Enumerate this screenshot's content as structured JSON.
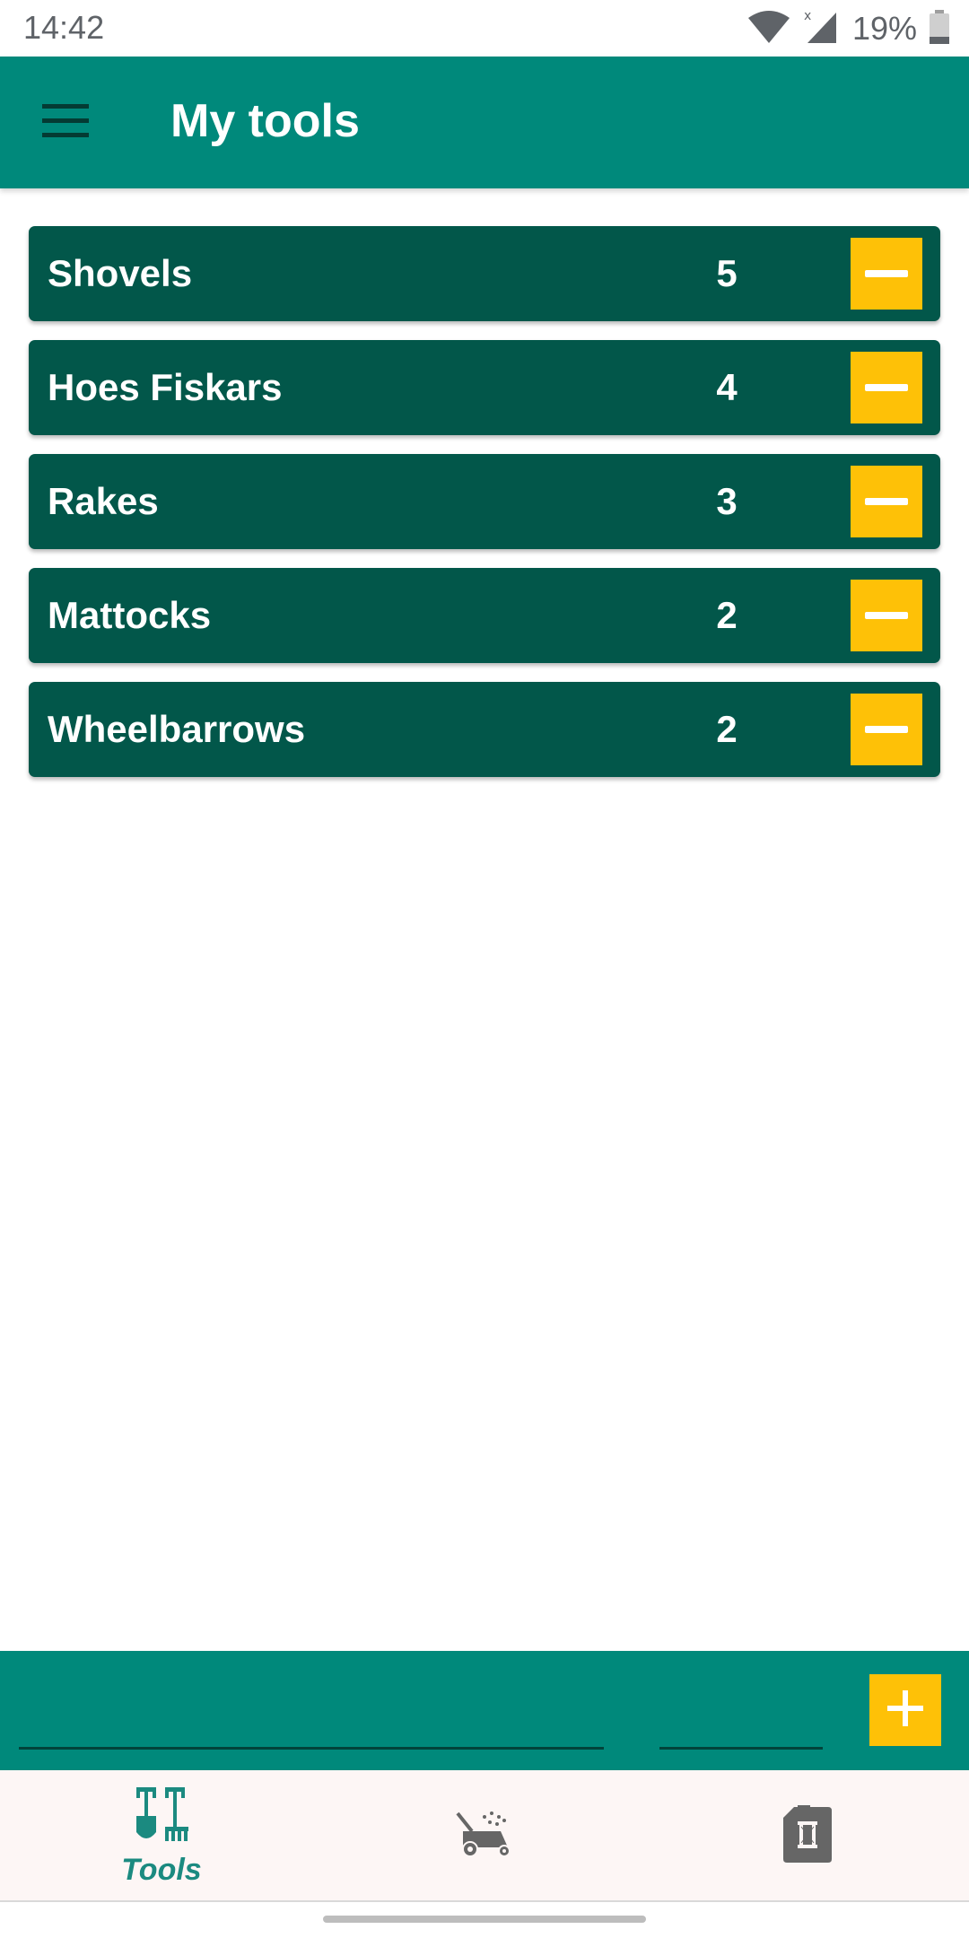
{
  "status_bar": {
    "time": "14:42",
    "battery_percent": "19%",
    "icons": [
      "wifi-icon",
      "signal-icon",
      "battery-icon"
    ]
  },
  "app_bar": {
    "title": "My tools",
    "menu_icon": "hamburger-menu-icon"
  },
  "tools": [
    {
      "name": "Shovels",
      "count": "5"
    },
    {
      "name": "Hoes Fiskars",
      "count": "4"
    },
    {
      "name": "Rakes",
      "count": "3"
    },
    {
      "name": "Mattocks",
      "count": "2"
    },
    {
      "name": "Wheelbarrows",
      "count": "2"
    }
  ],
  "input_panel": {
    "name_value": "",
    "count_value": "",
    "add_icon": "plus-icon"
  },
  "bottom_nav": {
    "items": [
      {
        "label": "Tools",
        "icon": "shovel-rake-icon",
        "active": true
      },
      {
        "label": "",
        "icon": "lawn-mower-icon",
        "active": false
      },
      {
        "label": "",
        "icon": "fuel-canister-icon",
        "active": false
      }
    ]
  },
  "colors": {
    "primary": "#00897b",
    "item_background": "#02574a",
    "accent": "#fec107",
    "nav_background": "#fdf6f5",
    "nav_active": "#1b8a80",
    "nav_inactive": "#666666"
  }
}
